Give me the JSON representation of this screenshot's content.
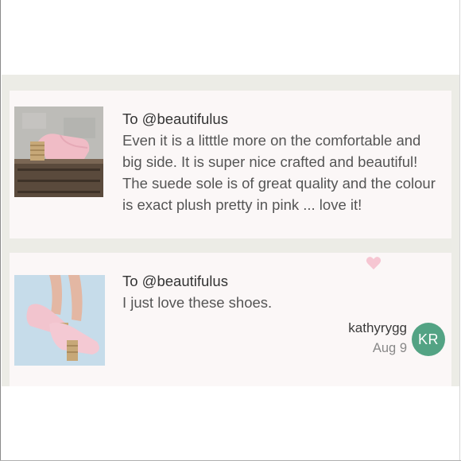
{
  "comments": [
    {
      "recipient": "To @beautifulus",
      "message": "Even it is a litttle more on the comfortable and big side. It is super nice crafted and beautiful! The suede sole is of great quality and the colour is exact plush pretty in pink ... love it!",
      "thumbnail_icon": "pink-mule-on-crate-photo"
    },
    {
      "recipient": "To @beautifulus",
      "message": "I just love these shoes.",
      "thumbnail_icon": "pink-mules-worn-photo",
      "like_icon": "heart-icon",
      "username": "kathyrygg",
      "date": "Aug 9",
      "avatar_initials": "KR"
    }
  ],
  "colors": {
    "card_background": "#fbf7f7",
    "feed_background": "#ecece6",
    "avatar": "#53a384",
    "heart": "#f6c6d2"
  }
}
